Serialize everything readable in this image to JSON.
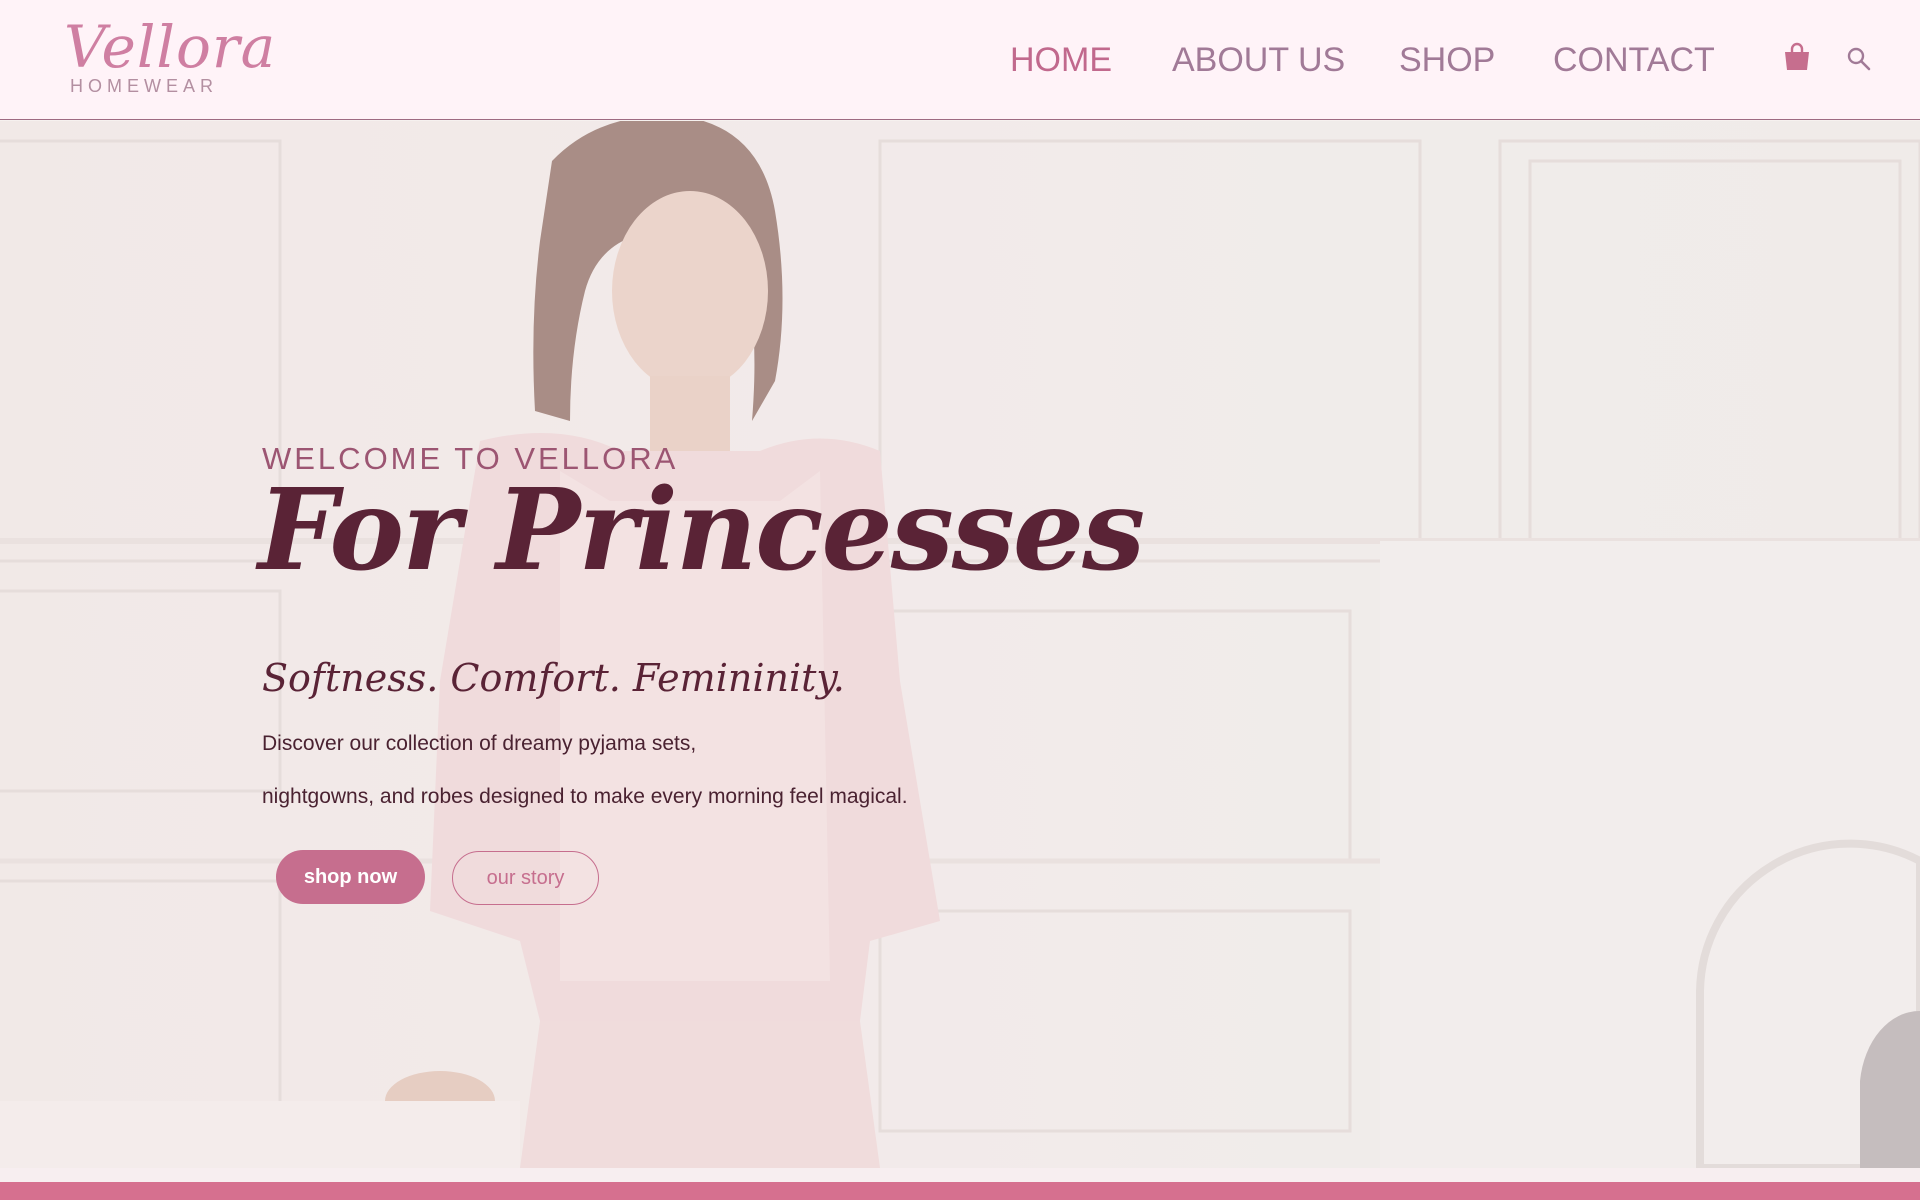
{
  "brand": {
    "name": "Vellora",
    "subtitle": "HOMEWEAR"
  },
  "nav": {
    "items": [
      {
        "label": "HOME",
        "active": true
      },
      {
        "label": "ABOUT US",
        "active": false
      },
      {
        "label": "SHOP",
        "active": false
      },
      {
        "label": "CONTACT",
        "active": false
      }
    ],
    "icons": [
      "shopping-bag-icon",
      "search-icon"
    ]
  },
  "hero": {
    "eyebrow": "WELCOME TO VELLORA",
    "title": "For Princesses",
    "tagline": "Softness. Comfort. Femininity.",
    "description_line1": "Discover our collection of dreamy pyjama sets,",
    "description_line2": "nightgowns, and robes designed to make every morning feel magical.",
    "primary_button": "shop now",
    "secondary_button": "our story"
  },
  "colors": {
    "header_bg": "#fff3f8",
    "accent": "#c66e8e",
    "title": "#5a2336",
    "nav_text": "#a17a97",
    "footer_strip": "#d6708f"
  }
}
